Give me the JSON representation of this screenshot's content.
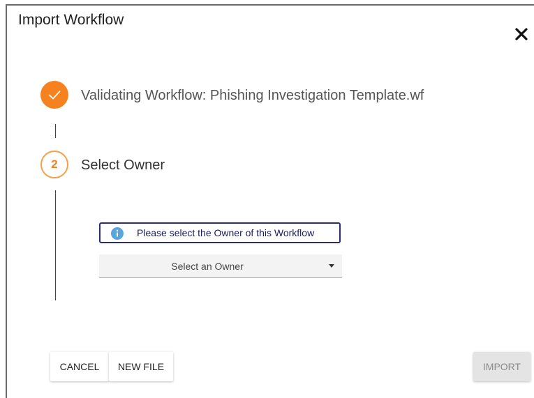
{
  "dialog": {
    "title": "Import Workflow",
    "close_icon": "close-icon"
  },
  "steps": [
    {
      "status": "completed",
      "icon": "checkmark-icon",
      "label": "Validating Workflow: Phishing Investigation Template.wf"
    },
    {
      "status": "active",
      "number": "2",
      "label": "Select Owner"
    }
  ],
  "owner_section": {
    "info_icon": "info-icon",
    "info_text": "Please select the Owner of this Workflow",
    "select_placeholder": "Select an Owner",
    "caret_icon": "caret-down-icon"
  },
  "footer": {
    "cancel_label": "CANCEL",
    "new_file_label": "NEW FILE",
    "import_label": "IMPORT",
    "import_enabled": false
  },
  "colors": {
    "accent": "#f5821f",
    "info_border": "#2b2d6e",
    "disabled_button": "#e4e4e4"
  }
}
